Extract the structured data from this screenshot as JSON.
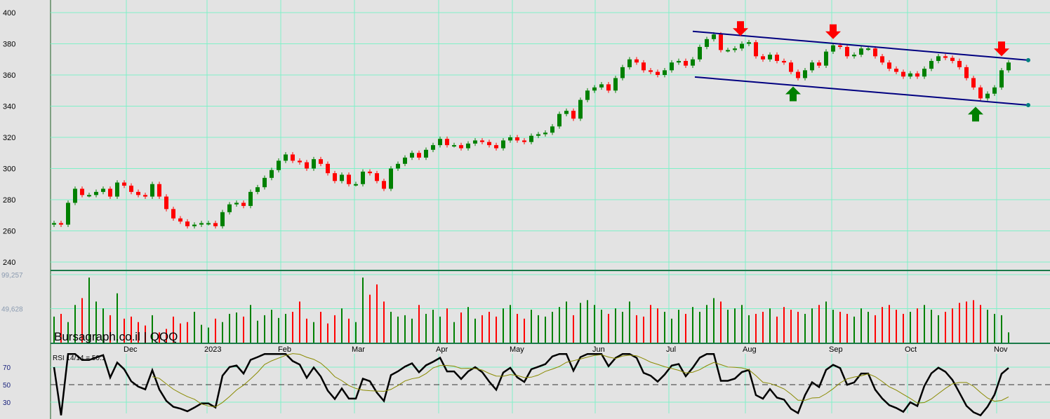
{
  "chart_data": {
    "type": "candlestick",
    "symbol_label": "Bursagraph.co.il | QQQ",
    "ylim": [
      230,
      402
    ],
    "y_ticks": [
      400,
      380,
      360,
      340,
      320,
      300,
      280,
      260,
      240
    ],
    "volume_ticks": [
      "99,257",
      "49,628"
    ],
    "volume_tick_values": [
      99257,
      49628
    ],
    "rsi_label": "RSI 14/14 = 50.1",
    "rsi_ticks": [
      70,
      50,
      30
    ],
    "months": [
      {
        "label": "Dec",
        "index": 10.3
      },
      {
        "label": "2023",
        "index": 21.8
      },
      {
        "label": "Feb",
        "index": 32.3
      },
      {
        "label": "Mar",
        "index": 42.8
      },
      {
        "label": "Apr",
        "index": 54.8
      },
      {
        "label": "May",
        "index": 65.3
      },
      {
        "label": "Jun",
        "index": 77.1
      },
      {
        "label": "Jul",
        "index": 87.6
      },
      {
        "label": "Aug",
        "index": 98.5
      },
      {
        "label": "Sep",
        "index": 110.8
      },
      {
        "label": "Oct",
        "index": 121.6
      },
      {
        "label": "Nov",
        "index": 134.3
      }
    ],
    "closes": [
      265,
      264,
      278,
      287,
      283,
      283,
      285,
      287,
      282,
      291,
      289,
      285,
      283,
      282,
      290,
      282,
      274,
      268,
      266,
      263,
      264,
      265,
      265,
      263,
      272,
      277,
      278,
      276,
      285,
      288,
      294,
      299,
      305,
      309,
      305,
      304,
      300,
      306,
      303,
      297,
      292,
      296,
      290,
      290,
      298,
      297,
      292,
      287,
      300,
      303,
      307,
      310,
      307,
      312,
      315,
      319,
      315,
      315,
      313,
      316,
      318,
      317,
      315,
      313,
      318,
      320,
      318,
      317,
      321,
      322,
      323,
      327,
      335,
      337,
      332,
      344,
      350,
      352,
      354,
      350,
      358,
      365,
      370,
      368,
      363,
      362,
      360,
      363,
      368,
      369,
      366,
      370,
      378,
      383,
      386,
      376,
      376,
      377,
      380,
      381,
      372,
      370,
      373,
      369,
      368,
      362,
      358,
      363,
      368,
      366,
      375,
      379,
      378,
      372,
      373,
      377,
      377,
      372,
      368,
      364,
      362,
      359,
      361,
      359,
      364,
      369,
      372,
      371,
      369,
      365,
      358,
      352,
      345,
      348,
      352,
      363,
      368
    ],
    "volumes": [
      38,
      42,
      30,
      55,
      65,
      95,
      60,
      50,
      40,
      72,
      35,
      38,
      30,
      25,
      40,
      15,
      20,
      38,
      28,
      30,
      45,
      26,
      22,
      35,
      30,
      42,
      44,
      38,
      55,
      32,
      40,
      48,
      36,
      42,
      45,
      60,
      35,
      30,
      45,
      28,
      40,
      50,
      35,
      30,
      95,
      70,
      85,
      60,
      45,
      38,
      40,
      35,
      55,
      42,
      48,
      38,
      50,
      30,
      44,
      52,
      35,
      40,
      45,
      38,
      50,
      55,
      42,
      35,
      48,
      40,
      38,
      45,
      52,
      60,
      40,
      58,
      62,
      55,
      48,
      42,
      50,
      45,
      60,
      40,
      38,
      55,
      50,
      45,
      35,
      48,
      42,
      52,
      45,
      55,
      65,
      60,
      48,
      50,
      55,
      40,
      42,
      45,
      50,
      38,
      52,
      48,
      45,
      42,
      50,
      55,
      60,
      48,
      45,
      42,
      38,
      50,
      45,
      40,
      52,
      55,
      48,
      42,
      45,
      50,
      55,
      48,
      40,
      45,
      50,
      58,
      60,
      62,
      55,
      48,
      42,
      40,
      15
    ],
    "channel": {
      "upper": [
        {
          "index": 91,
          "value": 388
        },
        {
          "index": 138.8,
          "value": 369.5
        }
      ],
      "lower": [
        {
          "index": 91.3,
          "value": 358.7
        },
        {
          "index": 138.8,
          "value": 340.7
        }
      ]
    },
    "signals": [
      {
        "type": "sell",
        "index": 97.8
      },
      {
        "type": "buy",
        "index": 105.3
      },
      {
        "type": "sell",
        "index": 111
      },
      {
        "type": "buy",
        "index": 131.3
      },
      {
        "type": "sell",
        "index": 135
      }
    ],
    "colors": {
      "up": "#008000",
      "down": "#ff0000",
      "channel": "#000080",
      "grid": "#80f0c8"
    }
  }
}
